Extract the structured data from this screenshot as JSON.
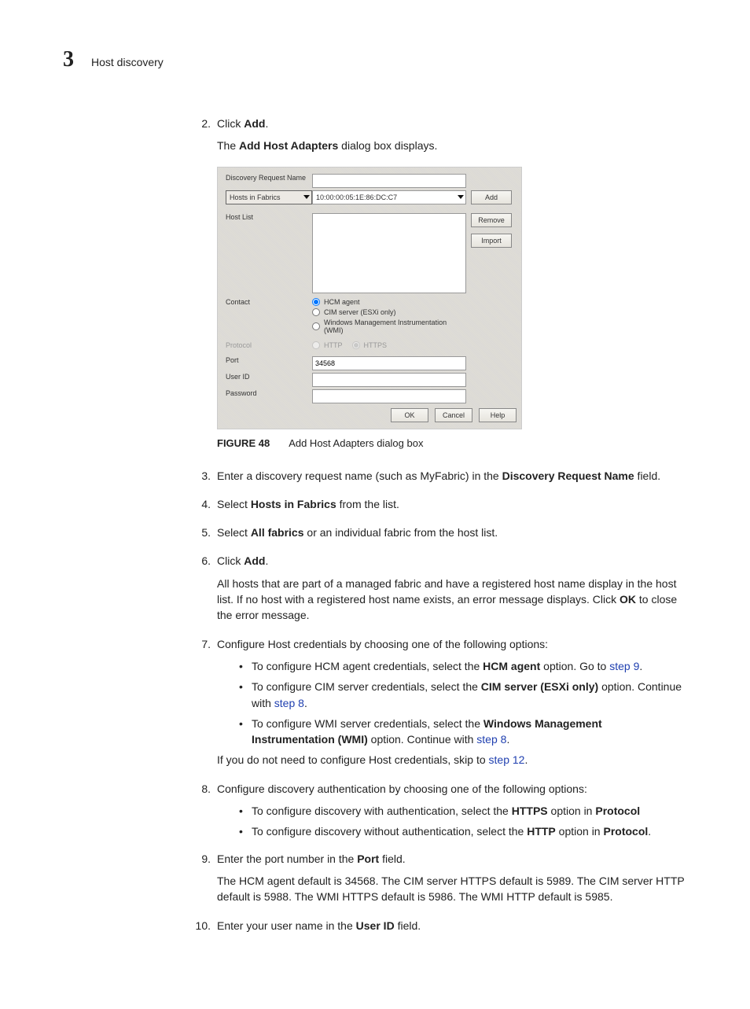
{
  "header": {
    "chapter": "3",
    "title": "Host discovery"
  },
  "steps": {
    "s2": {
      "num": "2.",
      "click": "Click ",
      "add": "Add",
      "period": ".",
      "desc_pre": "The ",
      "desc_bold": "Add Host Adapters",
      "desc_post": " dialog box displays."
    },
    "s3": {
      "num": "3.",
      "t1": "Enter a discovery request name (such as MyFabric) in the ",
      "b1": "Discovery Request Name",
      "t2": " field."
    },
    "s4": {
      "num": "4.",
      "t1": "Select ",
      "b1": "Hosts in Fabrics",
      "t2": " from the list."
    },
    "s5": {
      "num": "5.",
      "t1": "Select ",
      "b1": "All fabrics",
      "t2": " or an individual fabric from the host list."
    },
    "s6": {
      "num": "6.",
      "t1": "Click ",
      "b1": "Add",
      "t2": ".",
      "desc1": "All hosts that are part of a managed fabric and have a registered host name display in the host list. If no host with a registered host name exists, an error message displays. Click ",
      "b2": "OK",
      "desc2": " to close the error message."
    },
    "s7": {
      "num": "7.",
      "t1": "Configure Host credentials by choosing one of the following options:",
      "b_a1": "To configure HCM agent credentials, select the ",
      "b_a1b": "HCM agent",
      "b_a2": " option. Go to ",
      "b_a_link": "step 9",
      "b_a3": ".",
      "b_b1": "To configure CIM server credentials, select the ",
      "b_b1b": "CIM server (ESXi only)",
      "b_b2": " option. Continue with ",
      "b_b_link": "step 8",
      "b_b3": ".",
      "b_c1": "To configure WMI server credentials, select the ",
      "b_c1b": "Windows Management Instrumentation (WMI)",
      "b_c2": " option. Continue with ",
      "b_c_link": "step 8",
      "b_c3": ".",
      "skip1": "If you do not need to configure Host credentials, skip to ",
      "skip_link": "step 12",
      "skip2": "."
    },
    "s8": {
      "num": "8.",
      "t1": "Configure discovery authentication by choosing one of the following options:",
      "b_a1": "To configure discovery with authentication, select the ",
      "b_a1b": "HTTPS",
      "b_a2": " option in ",
      "b_a2b": "Protocol",
      "b_b1": "To configure discovery without authentication, select the ",
      "b_b1b": "HTTP",
      "b_b2": " option in ",
      "b_b2b": "Protocol",
      "b_b3": "."
    },
    "s9": {
      "num": "9.",
      "t1": "Enter the port number in the ",
      "b1": "Port",
      "t2": " field.",
      "desc": "The HCM agent default is 34568. The CIM server HTTPS default is 5989. The CIM server HTTP default is 5988. The WMI HTTPS default is 5986. The WMI HTTP default is 5985."
    },
    "s10": {
      "num": "10.",
      "t1": "Enter your user name in the ",
      "b1": "User ID",
      "t2": " field."
    }
  },
  "dialog": {
    "labels": {
      "drn": "Discovery Request Name",
      "hif": "Hosts in Fabrics",
      "hlist": "Host List",
      "contact": "Contact",
      "protocol": "Protocol",
      "port": "Port",
      "userid": "User ID",
      "password": "Password"
    },
    "fabric_selected": "10:00:00:05:1E:86:DC:C7",
    "radios": {
      "hcm": "HCM agent",
      "cim": "CIM server (ESXi only)",
      "wmi": "Windows Management Instrumentation (WMI)",
      "http": "HTTP",
      "https": "HTTPS"
    },
    "port_value": "34568",
    "buttons": {
      "add": "Add",
      "remove": "Remove",
      "import": "Import",
      "ok": "OK",
      "cancel": "Cancel",
      "help": "Help"
    }
  },
  "caption": {
    "label": "FIGURE 48",
    "text": "Add Host Adapters dialog box"
  }
}
